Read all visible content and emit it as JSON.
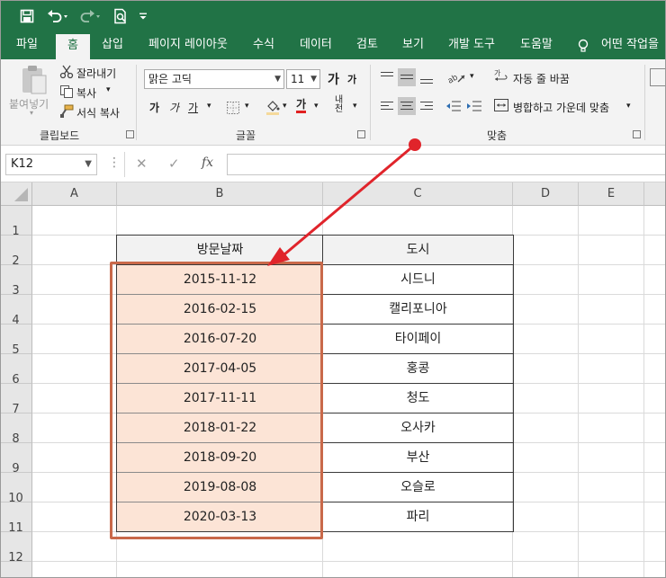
{
  "colors": {
    "excel_green": "#217346",
    "date_fill": "#fce4d6",
    "highlight_border": "#c9694a",
    "arrow": "#e0242b"
  },
  "title_bar": {
    "icons": [
      "save-icon",
      "undo-icon",
      "redo-icon",
      "print-preview-icon",
      "customize-qat-icon"
    ]
  },
  "tabs": [
    "파일",
    "홈",
    "삽입",
    "페이지 레이아웃",
    "수식",
    "데이터",
    "검토",
    "보기",
    "개발 도구",
    "도움말"
  ],
  "active_tab": "홈",
  "tell_me": "어떤 작업을",
  "ribbon": {
    "clipboard": {
      "paste": "붙여넣기",
      "cut": "잘라내기",
      "copy": "복사",
      "format_painter": "서식 복사",
      "label": "클립보드"
    },
    "font": {
      "name": "맑은 고딕",
      "size": "11",
      "grow": "가",
      "shrink": "가",
      "bold": "가",
      "italic": "가",
      "underline": "가",
      "font_color": "가",
      "phonetic": "내천",
      "label": "글꼴"
    },
    "alignment": {
      "wrap_text": "자동 줄 바꿈",
      "merge_center": "병합하고 가운데 맞춤",
      "label": "맞춤"
    }
  },
  "formula_bar": {
    "name_box": "K12",
    "cancel": "✕",
    "enter": "✓",
    "fx": "fx",
    "value": ""
  },
  "sheet": {
    "columns": [
      "A",
      "B",
      "C",
      "D",
      "E"
    ],
    "rows": [
      "1",
      "2",
      "3",
      "4",
      "5",
      "6",
      "7",
      "8",
      "9",
      "10",
      "11",
      "12"
    ],
    "table": {
      "headers": [
        "방문날짜",
        "도시"
      ],
      "rows": [
        [
          "2015-11-12",
          "시드니"
        ],
        [
          "2016-02-15",
          "캘리포니아"
        ],
        [
          "2016-07-20",
          "타이페이"
        ],
        [
          "2017-04-05",
          "홍콩"
        ],
        [
          "2017-11-11",
          "청도"
        ],
        [
          "2018-01-22",
          "오사카"
        ],
        [
          "2018-09-20",
          "부산"
        ],
        [
          "2019-08-08",
          "오슬로"
        ],
        [
          "2020-03-13",
          "파리"
        ]
      ]
    }
  }
}
